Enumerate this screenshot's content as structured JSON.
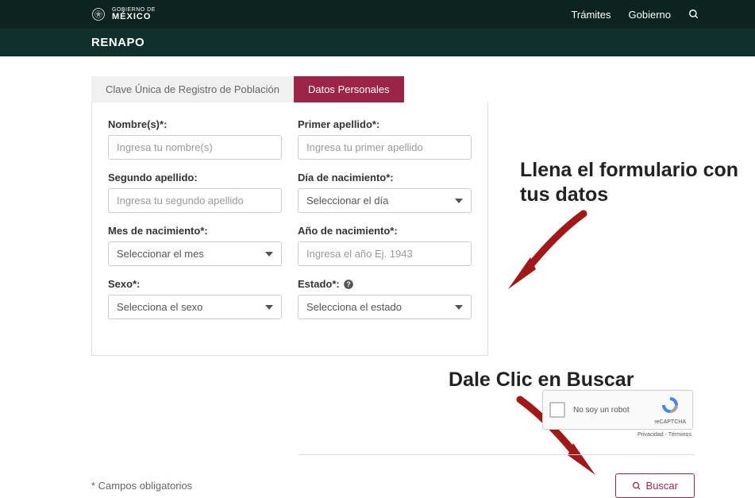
{
  "topbar": {
    "gov_line1": "GOBIERNO DE",
    "gov_line2": "MÉXICO",
    "links": {
      "tramites": "Trámites",
      "gobierno": "Gobierno"
    }
  },
  "subheader": {
    "title": "RENAPO"
  },
  "tabs": {
    "curp": "Clave Única de Registro de Población",
    "datos": "Datos Personales"
  },
  "form": {
    "nombres": {
      "label": "Nombre(s)*:",
      "placeholder": "Ingresa tu nombre(s)"
    },
    "primer_apellido": {
      "label": "Primer apellido*:",
      "placeholder": "Ingresa tu primer apellido"
    },
    "segundo_apellido": {
      "label": "Segundo apellido:",
      "placeholder": "Ingresa tu segundo apellido"
    },
    "dia": {
      "label": "Día de nacimiento*:",
      "placeholder": "Seleccionar el día"
    },
    "mes": {
      "label": "Mes de nacimiento*:",
      "placeholder": "Seleccionar el mes"
    },
    "anio": {
      "label": "Año de nacimiento*:",
      "placeholder": "Ingresa el año Ej. 1943"
    },
    "sexo": {
      "label": "Sexo*:",
      "placeholder": "Selecciona el sexo"
    },
    "estado": {
      "label": "Estado*:",
      "placeholder": "Selecciona el estado"
    }
  },
  "annotations": {
    "fill_form": "Llena el formulario con tus datos",
    "click_search": "Dale Clic en Buscar"
  },
  "recaptcha": {
    "label": "No soy un robot",
    "brand": "reCAPTCHA",
    "terms": "Privacidad - Términos"
  },
  "footer": {
    "required_note": "* Campos obligatorios",
    "search_button": "Buscar"
  },
  "colors": {
    "brand": "#9d2449",
    "topbar": "#0c231e",
    "subheader": "#10312b",
    "arrow": "#a01818"
  }
}
